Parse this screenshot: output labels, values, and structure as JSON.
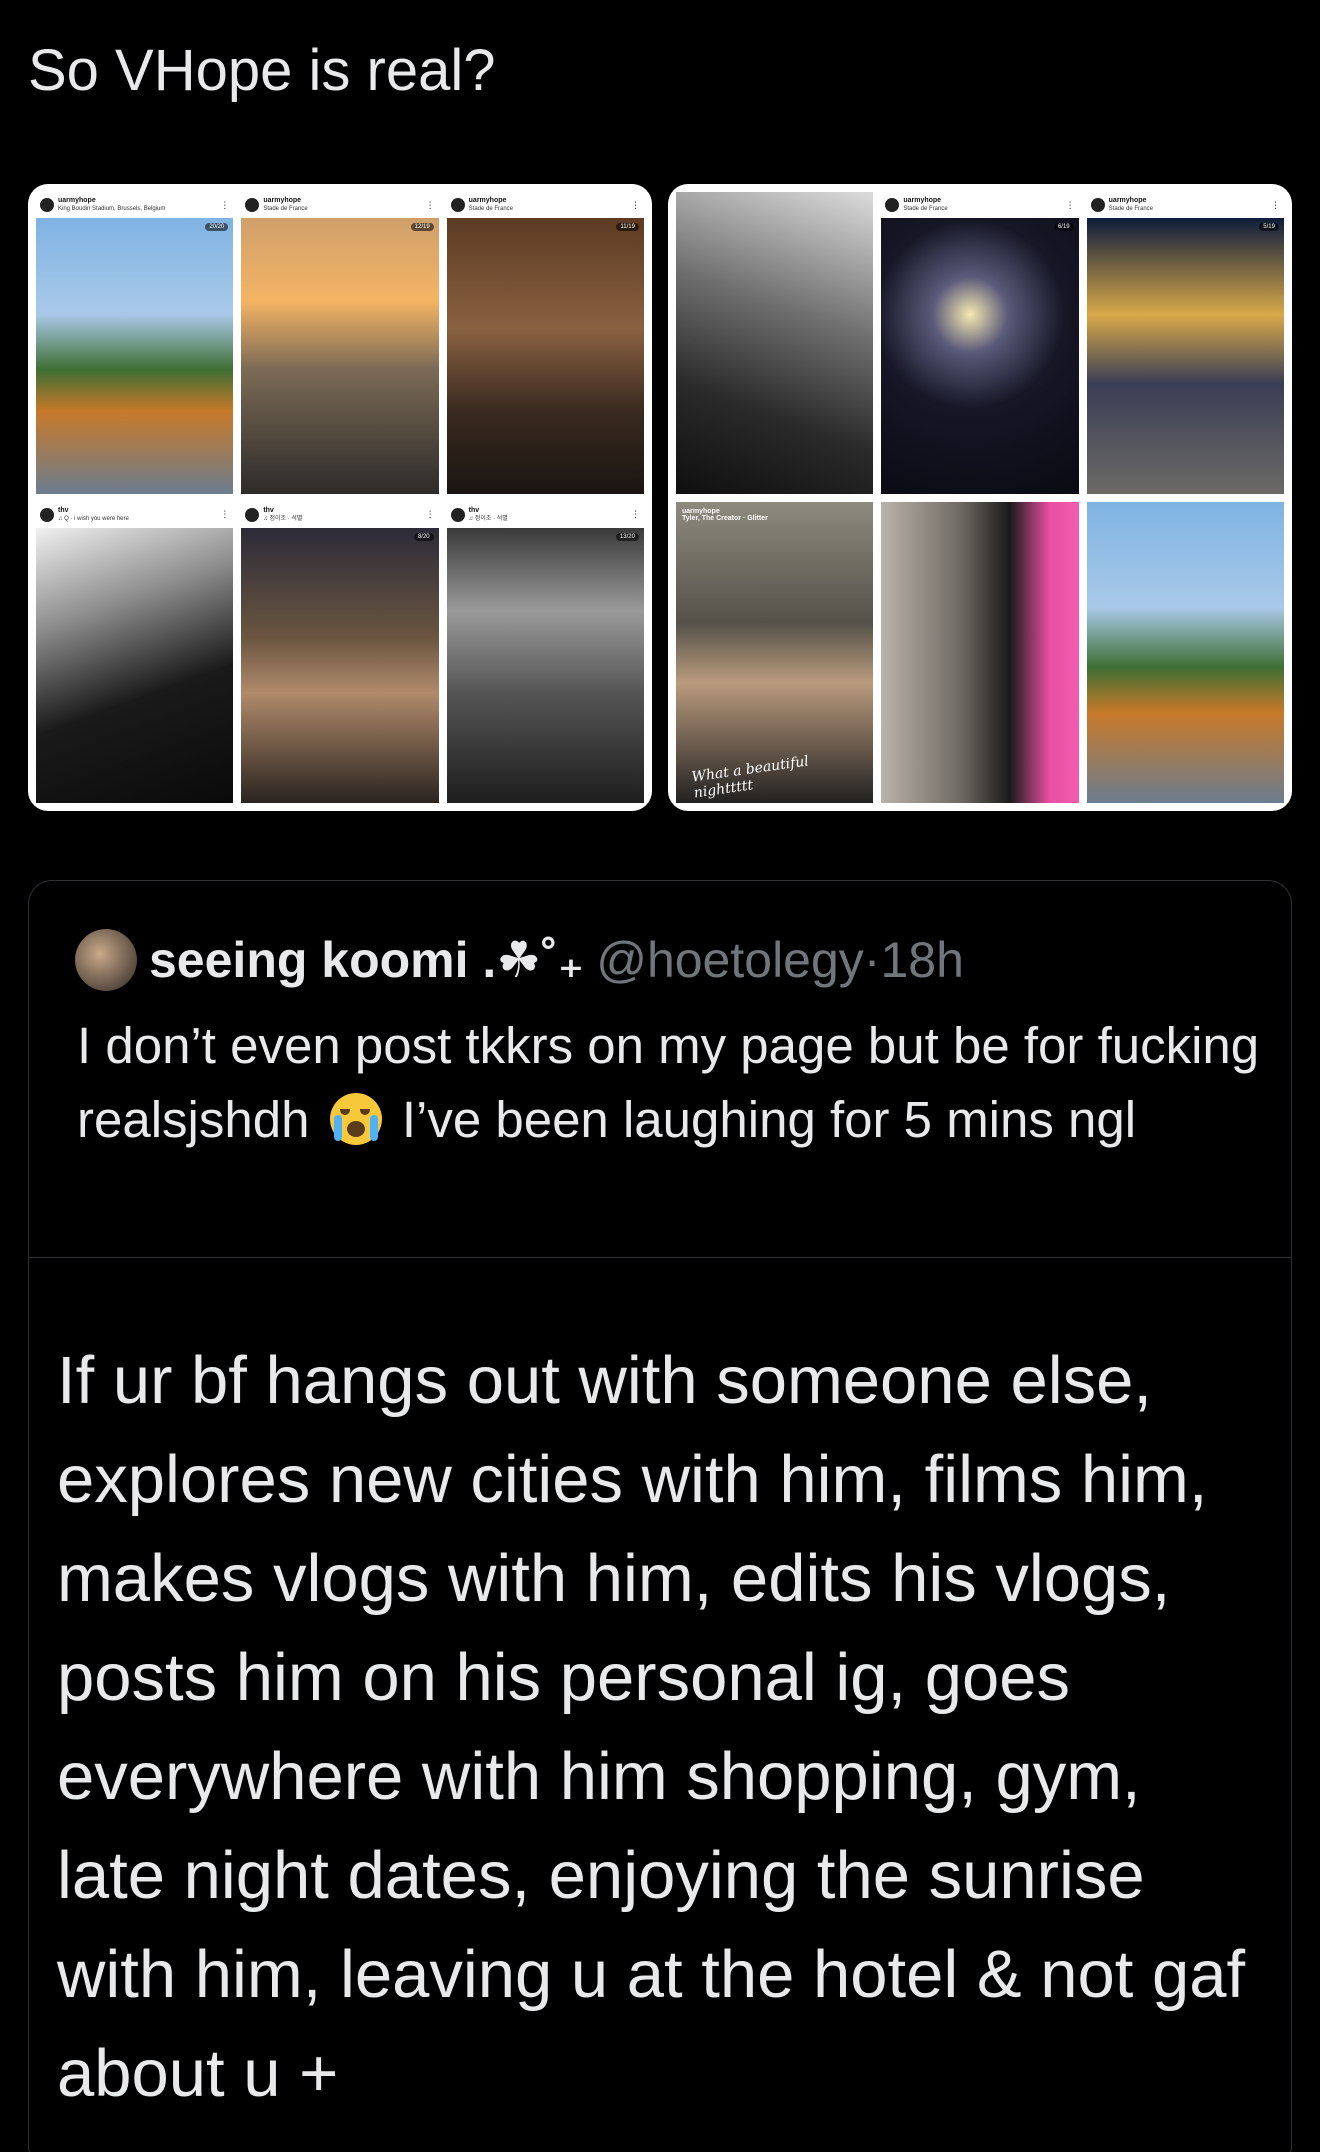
{
  "tweet": {
    "text": "So VHope is real?"
  },
  "media": {
    "left_card": [
      {
        "user": "uarmyhope",
        "location": "King Boudin Stadium, Brussels, Belgium",
        "count": "20/20"
      },
      {
        "user": "uarmyhope",
        "location": "Stade de France",
        "count": "12/19"
      },
      {
        "user": "uarmyhope",
        "location": "Stade de France",
        "count": "11/19"
      },
      {
        "user": "thv",
        "location": "♫ Q · i wish you were here",
        "count": ""
      },
      {
        "user": "thv",
        "location": "♫ 정이조 · 석별",
        "count": "8/20"
      },
      {
        "user": "thv",
        "location": "♫ 정이조 · 석별",
        "count": "13/20"
      }
    ],
    "right_card": [
      {
        "user": "",
        "location": "",
        "count": ""
      },
      {
        "user": "uarmyhope",
        "location": "Stade de France",
        "count": "6/19"
      },
      {
        "user": "uarmyhope",
        "location": "Stade de France",
        "count": "5/19"
      },
      {
        "user": "uarmyhope",
        "location": "Tyler, The Creator · Glitter",
        "count": "",
        "caption": "What a beautiful nighttttt"
      },
      {
        "user": "",
        "location": "",
        "count": ""
      },
      {
        "user": "",
        "location": "",
        "count": ""
      }
    ]
  },
  "quote": {
    "name": "seeing koomi .☘˚₊",
    "handle": "@hoetolegy",
    "time": "18h",
    "body_part1": "I don’t even post tkkrs on my page but be for fucking realsjshdh",
    "body_part2": "I’ve been laughing for 5 mins ngl",
    "emoji": "loudly-crying-face-icon",
    "screenshot_text": "If ur bf hangs out with someone else, explores new cities with him, films him, makes vlogs with him, edits his vlogs, posts him on his personal ig, goes everywhere with him shopping, gym, late night dates, enjoying the sunrise with him, leaving u at the hotel & not gaf about u +"
  }
}
